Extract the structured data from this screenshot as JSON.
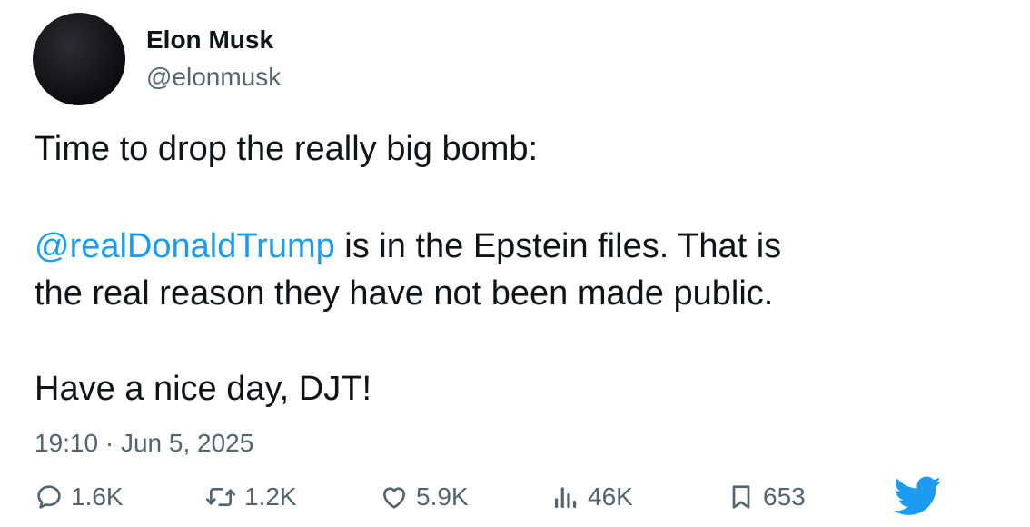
{
  "author": {
    "name": "Elon Musk",
    "handle": "@elonmusk"
  },
  "tweet": {
    "line1": "Time to drop the really big bomb:",
    "mention": "@realDonaldTrump",
    "line2_rest": " is in the Epstein files. That is",
    "line3": "the real reason they have not been made public.",
    "line4": "Have a nice day, DJT!",
    "timestamp": "19:10 · Jun 5, 2025"
  },
  "actions": {
    "replies": "1.6K",
    "retweets": "1.2K",
    "likes": "5.9K",
    "views": "46K",
    "bookmarks": "653"
  },
  "colors": {
    "accent": "#1d9bf0",
    "text": "#0f1419",
    "muted": "#536471"
  },
  "icons": [
    "reply-icon",
    "retweet-icon",
    "like-icon",
    "views-icon",
    "bookmark-icon",
    "twitter-bird-icon"
  ]
}
